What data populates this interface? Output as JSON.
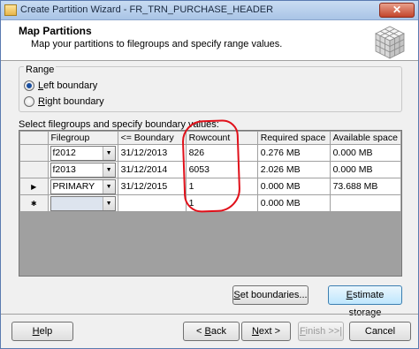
{
  "window": {
    "title": "Create Partition Wizard - FR_TRN_PURCHASE_HEADER",
    "close_label": "✕"
  },
  "header": {
    "title": "Map Partitions",
    "subtitle": "Map your partitions to filegroups and specify range values."
  },
  "range": {
    "label": "Range",
    "options": [
      {
        "label": "Left boundary",
        "accel": "L",
        "rest": "eft boundary",
        "checked": true
      },
      {
        "label": "Right boundary",
        "accel": "R",
        "rest": "ight boundary",
        "checked": false
      }
    ]
  },
  "grid": {
    "caption": "Select filegroups and specify boundary values:",
    "columns": [
      "Filegroup",
      "<= Boundary",
      "Rowcount",
      "Required space",
      "Available space"
    ],
    "rows": [
      {
        "marker": "",
        "filegroup": "f2012",
        "boundary": "31/12/2013",
        "rowcount": "826",
        "required": "0.276 MB",
        "available": "0.000 MB"
      },
      {
        "marker": "",
        "filegroup": "f2013",
        "boundary": "31/12/2014",
        "rowcount": "6053",
        "required": "2.026 MB",
        "available": "0.000 MB"
      },
      {
        "marker": "▶",
        "filegroup": "PRIMARY",
        "boundary": "31/12/2015",
        "rowcount": "1",
        "required": "0.000 MB",
        "available": "73.688 MB"
      },
      {
        "marker": "✱",
        "filegroup": "",
        "boundary": "",
        "rowcount": "1",
        "required": "0.000 MB",
        "available": ""
      }
    ]
  },
  "buttons": {
    "set_boundaries": {
      "accel": "S",
      "rest": "et boundaries..."
    },
    "estimate_storage": {
      "accel": "E",
      "rest": "stimate storage"
    },
    "help": {
      "accel": "H",
      "rest": "elp"
    },
    "back": {
      "prefix": "< ",
      "accel": "B",
      "rest": "ack"
    },
    "next": {
      "accel": "N",
      "rest": "ext >"
    },
    "finish": {
      "accel": "F",
      "rest": "inish >>|"
    },
    "cancel": {
      "label": "Cancel"
    }
  },
  "colors": {
    "annotation": "#e0101a",
    "titlebar": "#a9c4e6",
    "selected_radio": "#1a4fa0"
  }
}
